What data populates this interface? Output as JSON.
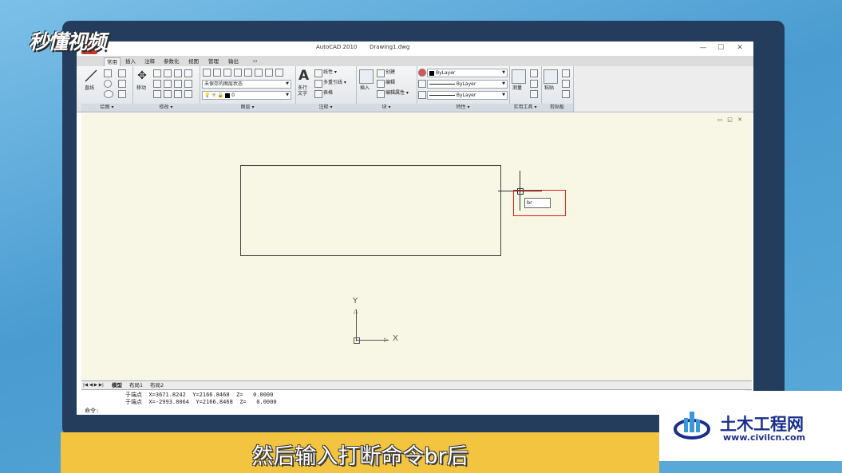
{
  "app": {
    "title": "AutoCAD 2010",
    "document": "Drawing1.dwg",
    "window_controls": [
      "—",
      "☐",
      "✕"
    ]
  },
  "ribbon": {
    "tabs": [
      "常用",
      "插入",
      "注释",
      "参数化",
      "视图",
      "管理",
      "输出"
    ],
    "active_tab": "常用",
    "panels": {
      "draw": {
        "title": "绘图 ▾",
        "line_label": "直线"
      },
      "modify": {
        "title": "修改 ▾",
        "move_label": "移动"
      },
      "layers": {
        "title": "图层 ▾",
        "layer_state": "未保存的图层状态",
        "current_layer": "0"
      },
      "annotation": {
        "title": "注释 ▾",
        "mtext_label": "多行文字",
        "linear_label": "线性 ▾",
        "multileader_label": "多重引线 ▾",
        "table_label": "表格"
      },
      "block": {
        "title": "块 ▾",
        "insert_label": "插入",
        "create_label": "创建",
        "edit_label": "编辑",
        "edit_attr_label": "编辑属性 ▾"
      },
      "properties": {
        "title": "特性 ▾",
        "color": "ByLayer",
        "linetype": "ByLayer",
        "lineweight": "ByLayer"
      },
      "utilities": {
        "title": "实用工具 ▾",
        "measure_label": "测量"
      },
      "clipboard": {
        "title": "剪贴板",
        "paste_label": "粘贴"
      }
    }
  },
  "drawing": {
    "dynamic_input_value": "br",
    "ucs": {
      "x_label": "X",
      "y_label": "Y"
    }
  },
  "layout_tabs": [
    "模型",
    "布局1",
    "布局2"
  ],
  "nav_arrows": "|◀ ◀ ▶ ▶|",
  "command_line": [
    "于端点  X=3671.8242  Y=2166.8468  Z=   0.0000",
    "于端点  X=-2993.8064  Y=2166.8468  Z=   0.0000",
    "命令:"
  ],
  "watermark_left": "秒懂视频",
  "watermark_right": {
    "name": "土木工程网",
    "url": "www.civilcn.com"
  },
  "subtitle": "然后输入打断命令br后",
  "colors": {
    "highlight": "#e02020",
    "subtitle_bar": "#f2c440",
    "bezel": "#243d5c",
    "canvas": "#f8f6e4"
  }
}
